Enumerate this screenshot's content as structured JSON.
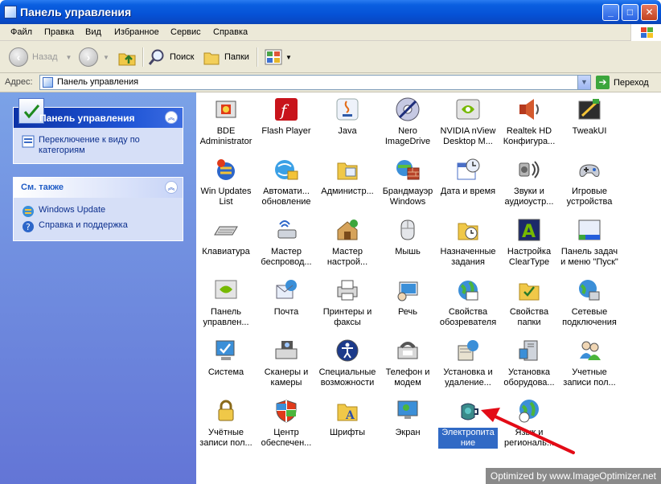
{
  "window": {
    "title": "Панель управления",
    "buttons": {
      "minimize": "_",
      "maximize": "□",
      "close": "✕"
    }
  },
  "menu": [
    "Файл",
    "Правка",
    "Вид",
    "Избранное",
    "Сервис",
    "Справка"
  ],
  "toolbar": {
    "back": "Назад",
    "search": "Поиск",
    "folders": "Папки"
  },
  "address": {
    "label": "Адрес:",
    "value": "Панель управления",
    "go": "Переход"
  },
  "sidebar": {
    "panel1": {
      "title": "Панель управления",
      "links": [
        "Переключение к виду по категориям"
      ]
    },
    "panel2": {
      "title": "См. также",
      "links": [
        "Windows Update",
        "Справка и поддержка"
      ]
    }
  },
  "items": [
    {
      "label": "BDE Administrator",
      "icon": "bde-icon"
    },
    {
      "label": "Flash Player",
      "icon": "flash-icon"
    },
    {
      "label": "Java",
      "icon": "java-icon"
    },
    {
      "label": "Nero ImageDrive",
      "icon": "nero-icon"
    },
    {
      "label": "NVIDIA nView Desktop M...",
      "icon": "nvidia-icon"
    },
    {
      "label": "Realtek HD Конфигура...",
      "icon": "speaker-icon"
    },
    {
      "label": "TweakUI",
      "icon": "tweakui-icon"
    },
    {
      "label": "Win Updates List",
      "icon": "win-updates-icon"
    },
    {
      "label": "Автомати... обновление",
      "icon": "auto-update-icon"
    },
    {
      "label": "Администр...",
      "icon": "admin-tools-icon"
    },
    {
      "label": "Брандмауэр Windows",
      "icon": "firewall-icon"
    },
    {
      "label": "Дата и время",
      "icon": "date-time-icon"
    },
    {
      "label": "Звуки и аудиоустр...",
      "icon": "sounds-icon"
    },
    {
      "label": "Игровые устройства",
      "icon": "gamepad-icon"
    },
    {
      "label": "Клавиатура",
      "icon": "keyboard-icon"
    },
    {
      "label": "Мастер беспровод...",
      "icon": "wireless-icon"
    },
    {
      "label": "Мастер настрой...",
      "icon": "network-wizard-icon"
    },
    {
      "label": "Мышь",
      "icon": "mouse-icon"
    },
    {
      "label": "Назначенные задания",
      "icon": "scheduled-tasks-icon"
    },
    {
      "label": "Настройка ClearType",
      "icon": "cleartype-icon"
    },
    {
      "label": "Панель задач и меню \"Пуск\"",
      "icon": "taskbar-icon"
    },
    {
      "label": "Панель управлен...",
      "icon": "nvidia-panel-icon"
    },
    {
      "label": "Почта",
      "icon": "mail-icon"
    },
    {
      "label": "Принтеры и факсы",
      "icon": "printer-icon"
    },
    {
      "label": "Речь",
      "icon": "speech-icon"
    },
    {
      "label": "Свойства обозревателя",
      "icon": "internet-options-icon"
    },
    {
      "label": "Свойства папки",
      "icon": "folder-options-icon"
    },
    {
      "label": "Сетевые подключения",
      "icon": "network-connections-icon"
    },
    {
      "label": "Система",
      "icon": "system-icon"
    },
    {
      "label": "Сканеры и камеры",
      "icon": "scanner-icon"
    },
    {
      "label": "Специальные возможности",
      "icon": "accessibility-icon"
    },
    {
      "label": "Телефон и модем",
      "icon": "phone-modem-icon"
    },
    {
      "label": "Установка и удаление...",
      "icon": "add-remove-icon"
    },
    {
      "label": "Установка оборудова...",
      "icon": "add-hardware-icon"
    },
    {
      "label": "Учетные записи пол...",
      "icon": "user-accounts-icon"
    },
    {
      "label": "Учётные записи пол...",
      "icon": "lock-icon"
    },
    {
      "label": "Центр обеспечен...",
      "icon": "security-center-icon"
    },
    {
      "label": "Шрифты",
      "icon": "fonts-icon"
    },
    {
      "label": "Экран",
      "icon": "display-icon"
    },
    {
      "label": "Электропита ние",
      "icon": "power-icon",
      "selected": true
    },
    {
      "label": "Язык и региональ...",
      "icon": "regional-icon"
    }
  ],
  "watermark": "Optimized by www.ImageOptimizer.net",
  "colors": {
    "selection": "#316ac5",
    "taskpane": "#7ba2e7",
    "titlebar": "#0652d6"
  }
}
